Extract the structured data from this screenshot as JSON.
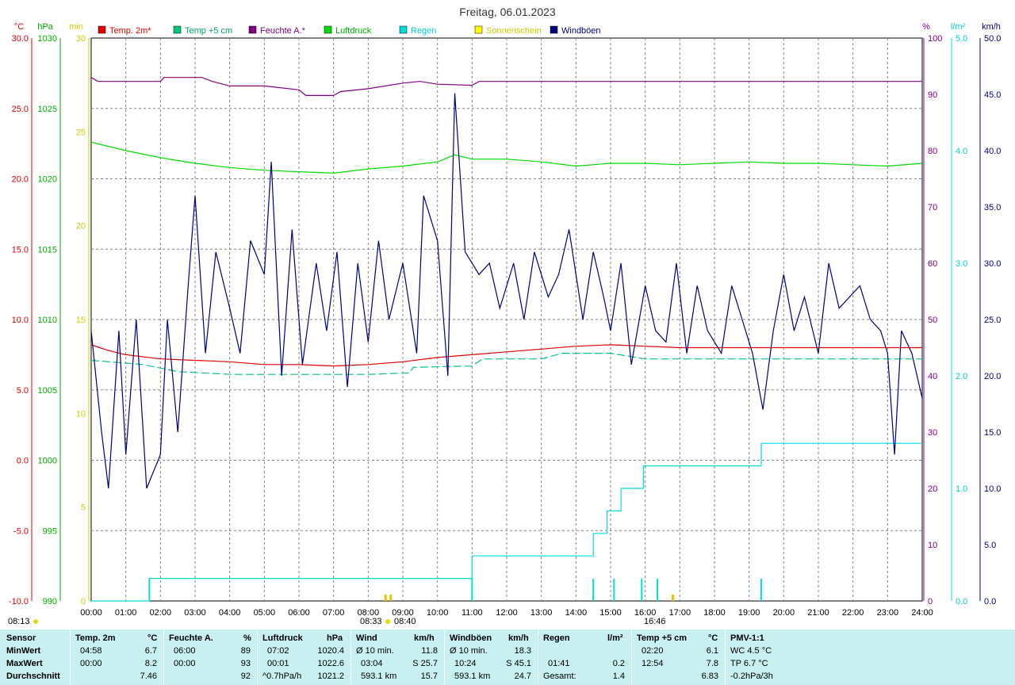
{
  "title": "Freitag, 06.01.2023",
  "colors": {
    "temp2m": "#e00000",
    "temp5cm": "#00c878",
    "humidity": "#800080",
    "pressure": "#00dd00",
    "rain": "#00dddd",
    "sunshine": "#ffff00",
    "gusts": "#000080",
    "grid": "#808080",
    "stats_bg": "#c8f0f0"
  },
  "legend": [
    "Temp. 2m*",
    "Temp +5 cm",
    "Feuchte A.*",
    "Luftdruck",
    "Regen",
    "Sonnenschein",
    "Windböen"
  ],
  "units": {
    "temp": "°C",
    "pressure": "hPa",
    "sun": "min",
    "humidity": "%",
    "rain": "l/m²",
    "wind": "km/h"
  },
  "sun_events": {
    "sunrise": "08:13",
    "marker1": "08:33",
    "marker2": "08:40",
    "sunset": "16:46"
  },
  "chart_data": {
    "type": "line",
    "x_ticks": [
      "00:00",
      "01:00",
      "02:00",
      "03:00",
      "04:00",
      "05:00",
      "06:00",
      "07:00",
      "08:00",
      "09:00",
      "10:00",
      "11:00",
      "12:00",
      "13:00",
      "14:00",
      "15:00",
      "16:00",
      "17:00",
      "18:00",
      "19:00",
      "20:00",
      "21:00",
      "22:00",
      "23:00",
      "24:00"
    ],
    "axes": {
      "temp": {
        "ylim": [
          -10,
          30
        ],
        "ticks": [
          "30.0",
          "25.0",
          "20.0",
          "15.0",
          "10.0",
          "5.0",
          "0.0",
          "-5.0",
          "-10.0"
        ]
      },
      "pressure": {
        "ylim": [
          990,
          1030
        ],
        "ticks": [
          "1030",
          "1025",
          "1020",
          "1015",
          "1010",
          "1005",
          "1000",
          "995",
          "990"
        ]
      },
      "sun": {
        "ylim": [
          0,
          30
        ],
        "ticks": [
          "30",
          "25",
          "20",
          "15",
          "10",
          "5",
          "0"
        ]
      },
      "humidity": {
        "ylim": [
          0,
          100
        ],
        "ticks": [
          "100",
          "90",
          "80",
          "70",
          "60",
          "50",
          "40",
          "30",
          "20",
          "10",
          "0"
        ]
      },
      "rain": {
        "ylim": [
          0,
          5
        ],
        "ticks": [
          "5.0",
          "4.0",
          "3.0",
          "2.0",
          "1.0",
          "0.0"
        ]
      },
      "wind": {
        "ylim": [
          0,
          50
        ],
        "ticks": [
          "50.0",
          "45.0",
          "40.0",
          "35.0",
          "30.0",
          "25.0",
          "20.0",
          "15.0",
          "10.0",
          "5.0",
          "0.0"
        ]
      }
    },
    "series": [
      {
        "name": "Temp. 2m*",
        "axis": "temp",
        "points": [
          [
            0,
            8.2
          ],
          [
            0.5,
            7.8
          ],
          [
            1,
            7.5
          ],
          [
            2,
            7.2
          ],
          [
            3,
            7.1
          ],
          [
            4,
            7.0
          ],
          [
            5,
            6.8
          ],
          [
            6,
            6.8
          ],
          [
            7,
            6.7
          ],
          [
            8,
            6.8
          ],
          [
            9,
            7.0
          ],
          [
            10,
            7.3
          ],
          [
            11,
            7.5
          ],
          [
            12,
            7.7
          ],
          [
            13,
            7.9
          ],
          [
            14,
            8.1
          ],
          [
            15,
            8.2
          ],
          [
            16,
            8.1
          ],
          [
            17,
            8.0
          ],
          [
            18,
            8.0
          ],
          [
            19,
            8.0
          ],
          [
            20,
            8.0
          ],
          [
            21,
            8.0
          ],
          [
            22,
            8.0
          ],
          [
            23,
            8.0
          ],
          [
            24,
            8.0
          ]
        ]
      },
      {
        "name": "Temp +5 cm",
        "axis": "temp",
        "points": [
          [
            0,
            7.1
          ],
          [
            1.5,
            6.8
          ],
          [
            2.5,
            6.3
          ],
          [
            4,
            6.1
          ],
          [
            6,
            6.1
          ],
          [
            8,
            6.1
          ],
          [
            9.2,
            6.2
          ],
          [
            9.3,
            6.6
          ],
          [
            11,
            6.7
          ],
          [
            11.3,
            7.2
          ],
          [
            13,
            7.2
          ],
          [
            13.6,
            7.6
          ],
          [
            15,
            7.6
          ],
          [
            16,
            7.2
          ],
          [
            18,
            7.2
          ],
          [
            20,
            7.2
          ],
          [
            22,
            7.2
          ],
          [
            24,
            7.2
          ]
        ]
      },
      {
        "name": "Feuchte A.*",
        "axis": "humidity",
        "points": [
          [
            0,
            93
          ],
          [
            0.2,
            92.3
          ],
          [
            2,
            92.3
          ],
          [
            2.1,
            93
          ],
          [
            3.2,
            93
          ],
          [
            3.5,
            92.3
          ],
          [
            4,
            91.5
          ],
          [
            5,
            91.5
          ],
          [
            6,
            90.8
          ],
          [
            6.2,
            89.8
          ],
          [
            7,
            89.8
          ],
          [
            7.2,
            90.5
          ],
          [
            8,
            91
          ],
          [
            9,
            92
          ],
          [
            9.5,
            92.3
          ],
          [
            10,
            91.8
          ],
          [
            11,
            91.6
          ],
          [
            11.2,
            92.3
          ],
          [
            14,
            92.3
          ],
          [
            18,
            92.3
          ],
          [
            24,
            92.3
          ]
        ]
      },
      {
        "name": "Luftdruck",
        "axis": "pressure",
        "points": [
          [
            0,
            1022.6
          ],
          [
            1,
            1022.0
          ],
          [
            2,
            1021.5
          ],
          [
            3,
            1021.1
          ],
          [
            4,
            1020.8
          ],
          [
            5,
            1020.6
          ],
          [
            6,
            1020.5
          ],
          [
            7,
            1020.4
          ],
          [
            8,
            1020.7
          ],
          [
            9,
            1020.9
          ],
          [
            10,
            1021.2
          ],
          [
            10.5,
            1021.7
          ],
          [
            11,
            1021.4
          ],
          [
            12,
            1021.4
          ],
          [
            13,
            1021.2
          ],
          [
            14,
            1020.9
          ],
          [
            15,
            1021.1
          ],
          [
            16,
            1021.1
          ],
          [
            17,
            1021.0
          ],
          [
            18,
            1021.1
          ],
          [
            19,
            1021.2
          ],
          [
            20,
            1021.1
          ],
          [
            21,
            1021.1
          ],
          [
            22,
            1021.0
          ],
          [
            23,
            1020.9
          ],
          [
            24,
            1021.1
          ]
        ]
      },
      {
        "name": "Regen",
        "axis": "rain",
        "points": [
          [
            0,
            0
          ],
          [
            1.68,
            0
          ],
          [
            1.68,
            0.2
          ],
          [
            11,
            0.2
          ],
          [
            11,
            0.4
          ],
          [
            14.5,
            0.4
          ],
          [
            14.5,
            0.6
          ],
          [
            14.9,
            0.6
          ],
          [
            14.9,
            0.8
          ],
          [
            15.3,
            0.8
          ],
          [
            15.3,
            1.0
          ],
          [
            15.95,
            1.0
          ],
          [
            15.95,
            1.2
          ],
          [
            16.35,
            1.2
          ],
          [
            16.35,
            1.2
          ],
          [
            19.35,
            1.2
          ],
          [
            19.35,
            1.4
          ],
          [
            24,
            1.4
          ]
        ]
      },
      {
        "name": "Windböen",
        "axis": "wind",
        "points": [
          [
            0,
            24
          ],
          [
            0.3,
            15
          ],
          [
            0.5,
            10
          ],
          [
            0.8,
            24
          ],
          [
            1,
            13
          ],
          [
            1.3,
            25
          ],
          [
            1.6,
            10
          ],
          [
            2,
            13
          ],
          [
            2.2,
            25
          ],
          [
            2.5,
            15
          ],
          [
            2.8,
            28
          ],
          [
            3,
            36
          ],
          [
            3.3,
            22
          ],
          [
            3.6,
            31
          ],
          [
            4,
            26
          ],
          [
            4.3,
            22
          ],
          [
            4.6,
            32
          ],
          [
            5,
            29
          ],
          [
            5.2,
            39
          ],
          [
            5.5,
            20
          ],
          [
            5.8,
            33
          ],
          [
            6.1,
            21
          ],
          [
            6.5,
            30
          ],
          [
            6.8,
            24
          ],
          [
            7.1,
            31
          ],
          [
            7.4,
            19
          ],
          [
            7.7,
            30
          ],
          [
            8,
            23
          ],
          [
            8.3,
            32
          ],
          [
            8.6,
            25
          ],
          [
            9,
            30
          ],
          [
            9.4,
            22
          ],
          [
            9.6,
            36
          ],
          [
            10,
            32
          ],
          [
            10.3,
            20
          ],
          [
            10.5,
            45.1
          ],
          [
            10.8,
            31
          ],
          [
            11.2,
            29
          ],
          [
            11.5,
            30
          ],
          [
            11.8,
            26
          ],
          [
            12.2,
            30
          ],
          [
            12.5,
            25
          ],
          [
            12.8,
            31
          ],
          [
            13.2,
            27
          ],
          [
            13.5,
            29
          ],
          [
            13.8,
            33
          ],
          [
            14.2,
            25
          ],
          [
            14.5,
            31
          ],
          [
            14.8,
            27
          ],
          [
            15,
            24
          ],
          [
            15.3,
            30
          ],
          [
            15.6,
            21
          ],
          [
            16,
            28
          ],
          [
            16.3,
            24
          ],
          [
            16.6,
            23
          ],
          [
            16.9,
            30
          ],
          [
            17.2,
            22
          ],
          [
            17.5,
            28
          ],
          [
            17.8,
            24
          ],
          [
            18.2,
            22
          ],
          [
            18.5,
            28
          ],
          [
            18.8,
            25
          ],
          [
            19.1,
            22
          ],
          [
            19.4,
            17
          ],
          [
            19.7,
            24
          ],
          [
            20,
            29
          ],
          [
            20.3,
            24
          ],
          [
            20.6,
            27
          ],
          [
            21,
            22
          ],
          [
            21.3,
            30
          ],
          [
            21.6,
            26
          ],
          [
            21.9,
            27
          ],
          [
            22.2,
            28
          ],
          [
            22.5,
            25
          ],
          [
            22.8,
            24
          ],
          [
            23,
            22
          ],
          [
            23.2,
            13
          ],
          [
            23.4,
            24
          ],
          [
            23.7,
            22
          ],
          [
            24,
            18
          ]
        ]
      }
    ],
    "rain_spikes": [
      1.68,
      11.0,
      14.5,
      15.1,
      15.9,
      16.35,
      19.35
    ],
    "sunshine_spikes": [
      8.5,
      8.65,
      16.8
    ]
  },
  "stats": {
    "header": [
      "Sensor",
      "Temp. 2m",
      "°C",
      "Feuchte A.",
      "%",
      "Luftdruck",
      "hPa",
      "Wind",
      "km/h",
      "Windböen",
      "km/h",
      "Regen",
      "l/m²",
      "Temp +5 cm",
      "°C",
      "PMV-1:1"
    ],
    "row_labels": [
      "MinWert",
      "MaxWert",
      "Durchschnitt"
    ],
    "temp2m": [
      [
        "04:58",
        "6.7"
      ],
      [
        "00:00",
        "8.2"
      ],
      [
        "",
        "7.46"
      ]
    ],
    "humidity": [
      [
        "06:00",
        "89"
      ],
      [
        "00:00",
        "93"
      ],
      [
        "",
        "92"
      ]
    ],
    "pressure": [
      [
        "07:02",
        "1020.4"
      ],
      [
        "00:01",
        "1022.6"
      ],
      [
        "^0.7hPa/h",
        "1021.2"
      ]
    ],
    "wind": [
      [
        "Ø 10 min.",
        "11.8"
      ],
      [
        "03:04",
        "S 25.7"
      ],
      [
        "593.1 km",
        "15.7"
      ]
    ],
    "gusts": [
      [
        "Ø 10 min.",
        "18.3"
      ],
      [
        "10:24",
        "S 45.1"
      ],
      [
        "593.1 km",
        "24.7"
      ]
    ],
    "rain": [
      [
        "",
        ""
      ],
      [
        "01:41",
        "0.2"
      ],
      [
        "Gesamt:",
        "1.4"
      ]
    ],
    "temp5cm": [
      [
        "02:20",
        "6.1"
      ],
      [
        "12:54",
        "7.8"
      ],
      [
        "",
        "6.83"
      ]
    ],
    "pmv": [
      "WC 4.5 °C",
      "TP 6.7 °C",
      "-0.2hPa/3h"
    ]
  }
}
